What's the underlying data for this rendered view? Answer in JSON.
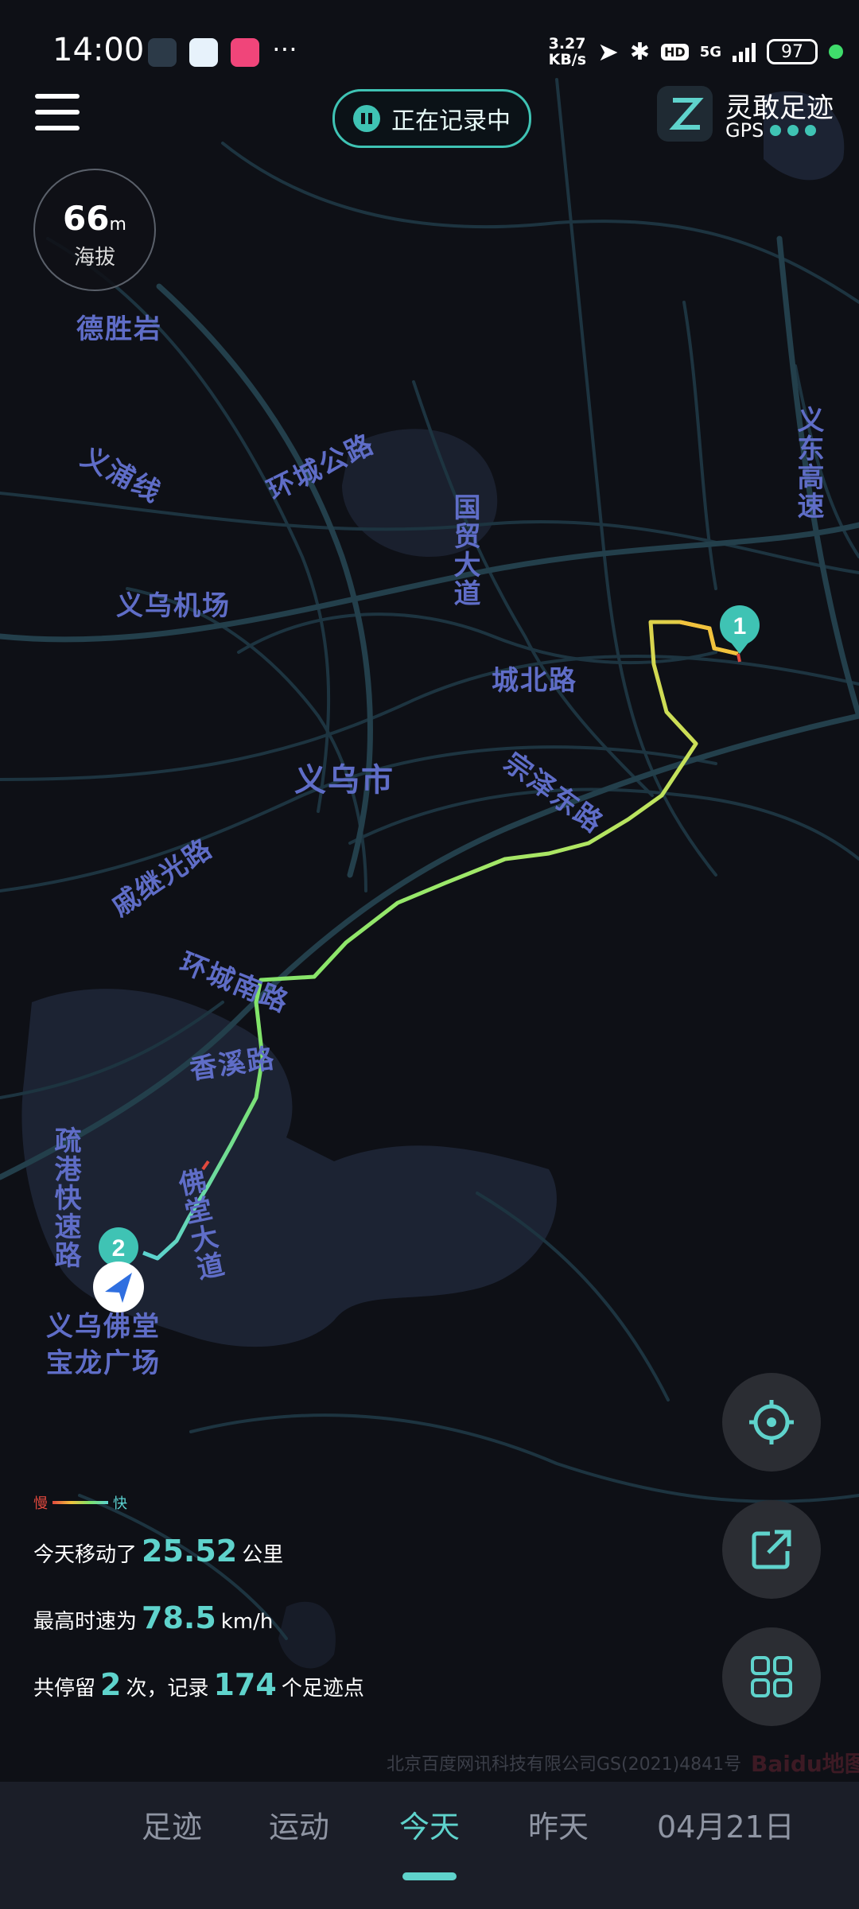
{
  "status_bar": {
    "time": "14:00",
    "net_speed_value": "3.27",
    "net_speed_unit": "KB/s",
    "hd": "HD",
    "network": "5G",
    "battery": "97"
  },
  "top": {
    "recording_label": "正在记录中",
    "brand_name": "灵敢足迹",
    "gps_label": "GPS"
  },
  "altitude": {
    "value": "66",
    "unit": "m",
    "label": "海拔"
  },
  "map_labels": {
    "deshengyan": "德胜岩",
    "yipu_line": "义浦线",
    "huancheng_n": "环城公路",
    "guomao": "国贸大道",
    "yidong": "义东高速",
    "airport": "义乌机场",
    "chengbei": "城北路",
    "zongze": "宗泽东路",
    "city": "义乌市",
    "qijiguang": "戚继光路",
    "huancheng_s": "环城南路",
    "xiangxi": "香溪路",
    "shugang": "疏港快速路",
    "fotang_road": "佛堂大道",
    "fotang_plaza_1": "义乌佛堂",
    "fotang_plaza_2": "宝龙广场",
    "marker_start": "1",
    "marker_end": "2"
  },
  "legend": {
    "slow": "慢",
    "fast": "快",
    "colors": [
      "#e2493e",
      "#f1c23d",
      "#7fe36a",
      "#5bd2d1"
    ]
  },
  "stats": {
    "distance_prefix": "今天移动了",
    "distance_value": "25.52",
    "distance_unit": "公里",
    "speed_prefix": "最高时速为",
    "speed_value": "78.5",
    "speed_unit": "km/h",
    "stops_prefix": "共停留",
    "stops_value": "2",
    "stops_mid": "次，记录",
    "points_value": "174",
    "points_suffix": "个足迹点"
  },
  "copyright": "北京百度网讯科技有限公司GS(2021)4841号",
  "map_provider": "Baidu地图",
  "tabs": [
    {
      "label": "足迹"
    },
    {
      "label": "运动"
    },
    {
      "label": "今天"
    },
    {
      "label": "昨天"
    },
    {
      "label": "04月21日"
    }
  ],
  "colors": {
    "accent": "#5fd3cc",
    "background": "#0e1016",
    "road": "#1f3844",
    "water": "#1d2433"
  }
}
